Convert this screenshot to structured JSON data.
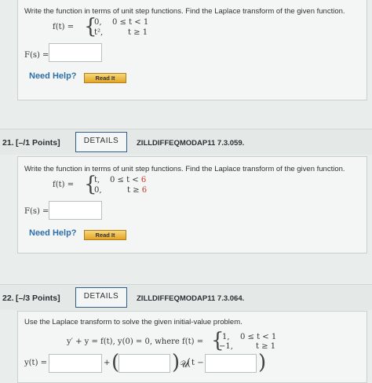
{
  "q20": {
    "instruction": "Write the function in terms of unit step functions. Find the Laplace transform of the given function.",
    "f_label": "f(t) =",
    "case1_val": "0,",
    "case1_cond": "0 ≤ t < 1",
    "case2_val": "t²,",
    "case2_cond": "t ≥ 1",
    "answer_label": "F(s) =",
    "answer_value": "",
    "need_help": "Need Help?",
    "read_it": "Read It"
  },
  "q21": {
    "number": "21.",
    "points": "[–/1 Points]",
    "details": "DETAILS",
    "code": "ZILLDIFFEQMODAP11 7.3.059.",
    "instruction": "Write the function in terms of unit step functions. Find the Laplace transform of the given function.",
    "f_label": "f(t) =",
    "case1_val": "t,",
    "case1_cond_a": "0 ≤ t < ",
    "case1_cond_b": "6",
    "case2_val": "0,",
    "case2_cond_a": "t ≥ ",
    "case2_cond_b": "6",
    "highlight_color": "#c0392b",
    "answer_label": "F(s) =",
    "answer_value": "",
    "need_help": "Need Help?",
    "read_it": "Read It"
  },
  "q22": {
    "number": "22.",
    "points": "[–/3 Points]",
    "details": "DETAILS",
    "code": "ZILLDIFFEQMODAP11 7.3.064.",
    "instruction": "Use the Laplace transform to solve the given initial-value problem.",
    "equation": "y′ + y = f(t),   y(0) = 0, where f(t) =",
    "case1_val": "1,",
    "case1_cond": "0 ≤ t < 1",
    "case2_val": "−1,",
    "case2_cond": "t ≥ 1",
    "answer_label": "y(t) =",
    "plus": "+",
    "unit_step": "𝒰",
    "t_minus": "t −",
    "answer1": "",
    "answer2": "",
    "answer3": ""
  }
}
